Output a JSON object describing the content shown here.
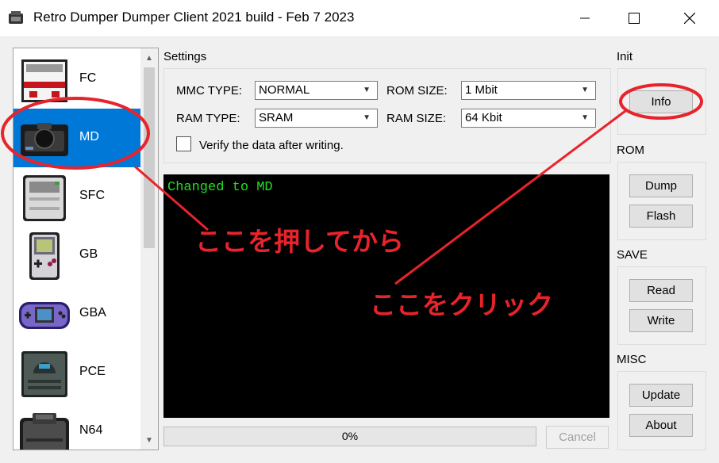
{
  "window": {
    "title": "Retro Dumper Dumper Client 2021 build - Feb  7 2023"
  },
  "consoles": [
    {
      "label": "FC",
      "selected": false
    },
    {
      "label": "MD",
      "selected": true
    },
    {
      "label": "SFC",
      "selected": false
    },
    {
      "label": "GB",
      "selected": false
    },
    {
      "label": "GBA",
      "selected": false
    },
    {
      "label": "PCE",
      "selected": false
    },
    {
      "label": "N64",
      "selected": false
    }
  ],
  "settings": {
    "group_label": "Settings",
    "mmc_type_label": "MMC TYPE:",
    "mmc_type_value": "NORMAL",
    "rom_size_label": "ROM SIZE:",
    "rom_size_value": "1 Mbit",
    "ram_type_label": "RAM TYPE:",
    "ram_type_value": "SRAM",
    "ram_size_label": "RAM SIZE:",
    "ram_size_value": "64 Kbit",
    "verify_label": "Verify the data after writing.",
    "verify_checked": false
  },
  "console_output": {
    "lines": [
      "Changed to MD"
    ],
    "text_color": "#22e022"
  },
  "progress": {
    "value_percent": 0,
    "text": "0%"
  },
  "cancel_button": "Cancel",
  "right_panel": {
    "init": {
      "label": "Init",
      "info_button": "Info"
    },
    "rom": {
      "label": "ROM",
      "dump_button": "Dump",
      "flash_button": "Flash"
    },
    "save": {
      "label": "SAVE",
      "read_button": "Read",
      "write_button": "Write"
    },
    "misc": {
      "label": "MISC",
      "update_button": "Update",
      "about_button": "About"
    }
  },
  "annotations": {
    "first": "ここを押してから",
    "second": "ここをクリック",
    "color": "#e8232b"
  },
  "colors": {
    "selection": "#0078d7",
    "console_bg": "#000000"
  }
}
